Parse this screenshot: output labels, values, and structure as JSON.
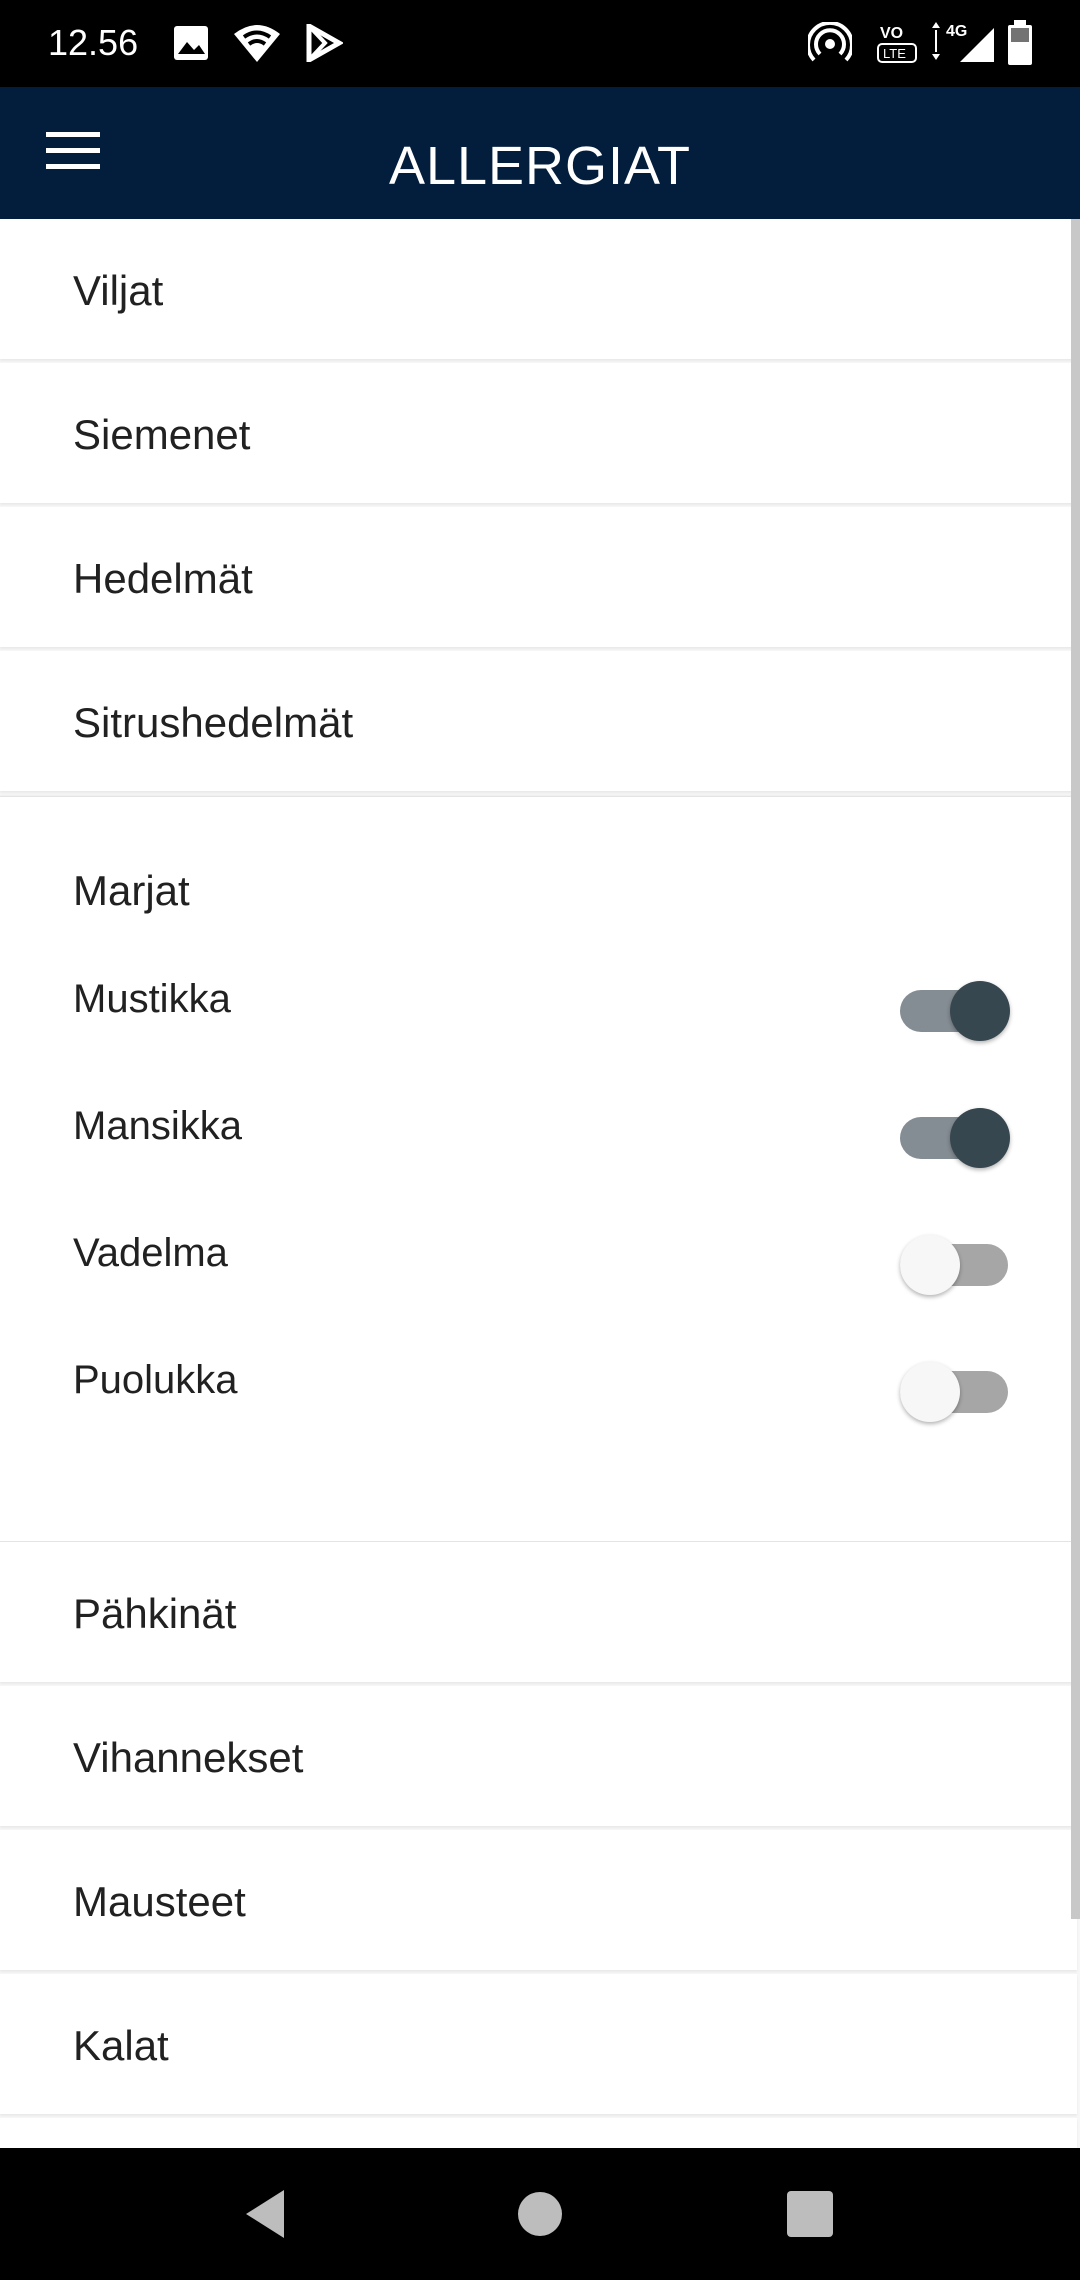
{
  "status_bar": {
    "time": "12.56",
    "icons": [
      "image-icon",
      "wifi-icon",
      "play-store-icon",
      "hotspot-icon",
      "volte-icon",
      "signal-4g-icon",
      "battery-icon"
    ],
    "network_label": "4G",
    "volte_label": "VoLTE"
  },
  "app_bar": {
    "title": "ALLERGIAT",
    "menu_icon": "hamburger-menu-icon",
    "background_color": "#031d3c"
  },
  "categories_top": [
    {
      "label": "Viljat"
    },
    {
      "label": "Siemenet"
    },
    {
      "label": "Hedelmät"
    },
    {
      "label": "Sitrushedelmät"
    }
  ],
  "expanded_category": {
    "label": "Marjat",
    "items": [
      {
        "label": "Mustikka",
        "enabled": true
      },
      {
        "label": "Mansikka",
        "enabled": true
      },
      {
        "label": "Vadelma",
        "enabled": false
      },
      {
        "label": "Puolukka",
        "enabled": false
      }
    ]
  },
  "categories_bottom": [
    {
      "label": "Pähkinät"
    },
    {
      "label": "Vihannekset"
    },
    {
      "label": "Mausteet"
    },
    {
      "label": "Kalat"
    }
  ],
  "nav_bar": {
    "buttons": [
      "back-icon",
      "home-icon",
      "recents-icon"
    ]
  },
  "colors": {
    "toggle_on_thumb": "#37474f",
    "toggle_on_track": "#858d94",
    "toggle_off_thumb": "#f7f7f7",
    "toggle_off_track": "#a6a6a6"
  }
}
